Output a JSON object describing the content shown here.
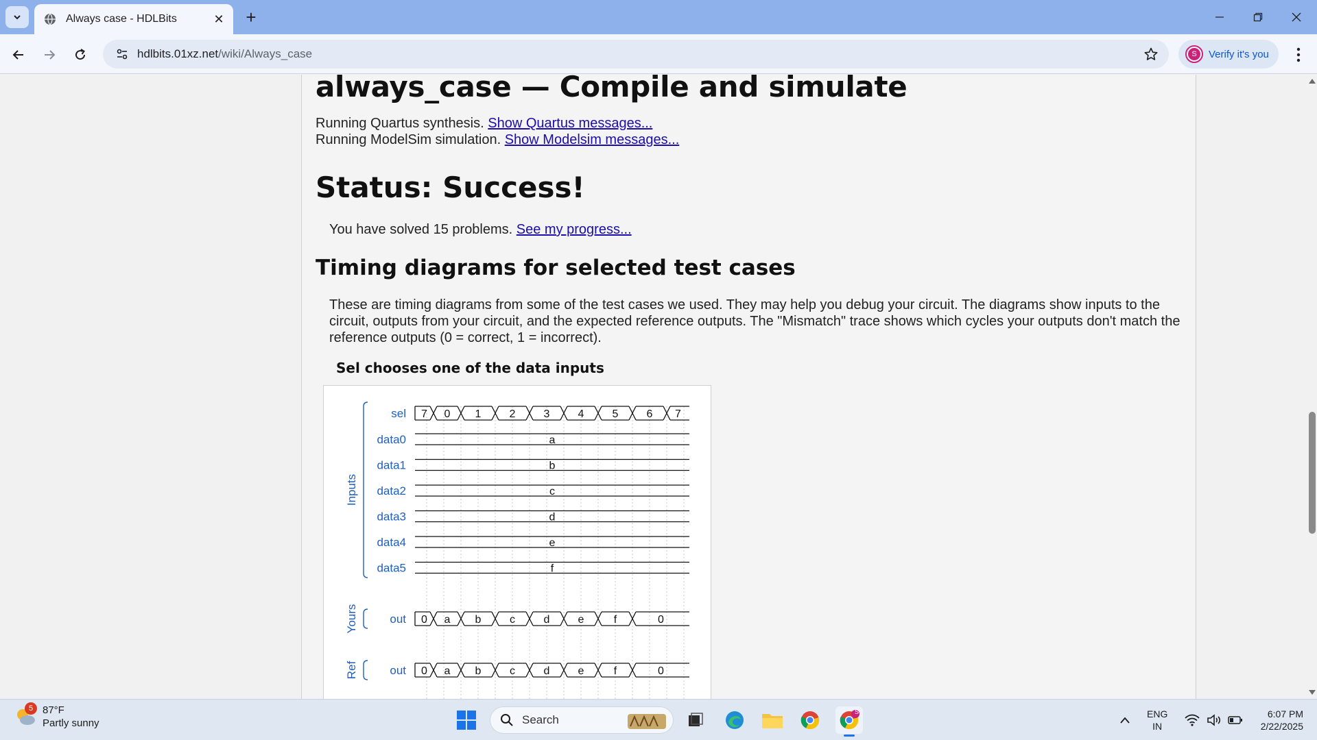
{
  "browser": {
    "tab_title": "Always case - HDLBits",
    "url_host": "hdlbits.01xz.net",
    "url_path": "/wiki/Always_case",
    "profile_label": "Verify it's you",
    "profile_initial": "S"
  },
  "page": {
    "heading": "always_case — Compile and simulate",
    "quartus_text": "Running Quartus synthesis.",
    "quartus_link": "Show Quartus messages...",
    "modelsim_text": "Running ModelSim simulation.",
    "modelsim_link": "Show Modelsim messages...",
    "status": "Status: Success!",
    "solved_text": "You have solved 15 problems.",
    "progress_link": "See my progress...",
    "timing_heading": "Timing diagrams for selected test cases",
    "timing_para": "These are timing diagrams from some of the test cases we used. They may help you debug your circuit. The diagrams show inputs to the circuit, outputs from your circuit, and the expected reference outputs. The \"Mismatch\" trace shows which cycles your outputs don't match the reference outputs (0 = correct, 1 = incorrect).",
    "diagram_caption": "Sel chooses one of the data inputs"
  },
  "timing": {
    "group_inputs": "Inputs",
    "group_yours": "Yours",
    "group_ref": "Ref",
    "sel": {
      "name": "sel",
      "values": [
        "7",
        "0",
        "1",
        "2",
        "3",
        "4",
        "5",
        "6",
        "7"
      ]
    },
    "data_signals": [
      {
        "name": "data0",
        "value": "a"
      },
      {
        "name": "data1",
        "value": "b"
      },
      {
        "name": "data2",
        "value": "c"
      },
      {
        "name": "data3",
        "value": "d"
      },
      {
        "name": "data4",
        "value": "e"
      },
      {
        "name": "data5",
        "value": "f"
      }
    ],
    "yours_out": {
      "name": "out",
      "values": [
        "0",
        "a",
        "b",
        "c",
        "d",
        "e",
        "f",
        "0"
      ]
    },
    "ref_out": {
      "name": "out",
      "values": [
        "0",
        "a",
        "b",
        "c",
        "d",
        "e",
        "f",
        "0"
      ]
    }
  },
  "taskbar": {
    "weather_badge": "5",
    "temperature": "87°F",
    "condition": "Partly sunny",
    "search_label": "Search",
    "lang_top": "ENG",
    "lang_bottom": "IN",
    "time": "6:07 PM",
    "date": "2/22/2025",
    "chrome_badge": "S"
  }
}
